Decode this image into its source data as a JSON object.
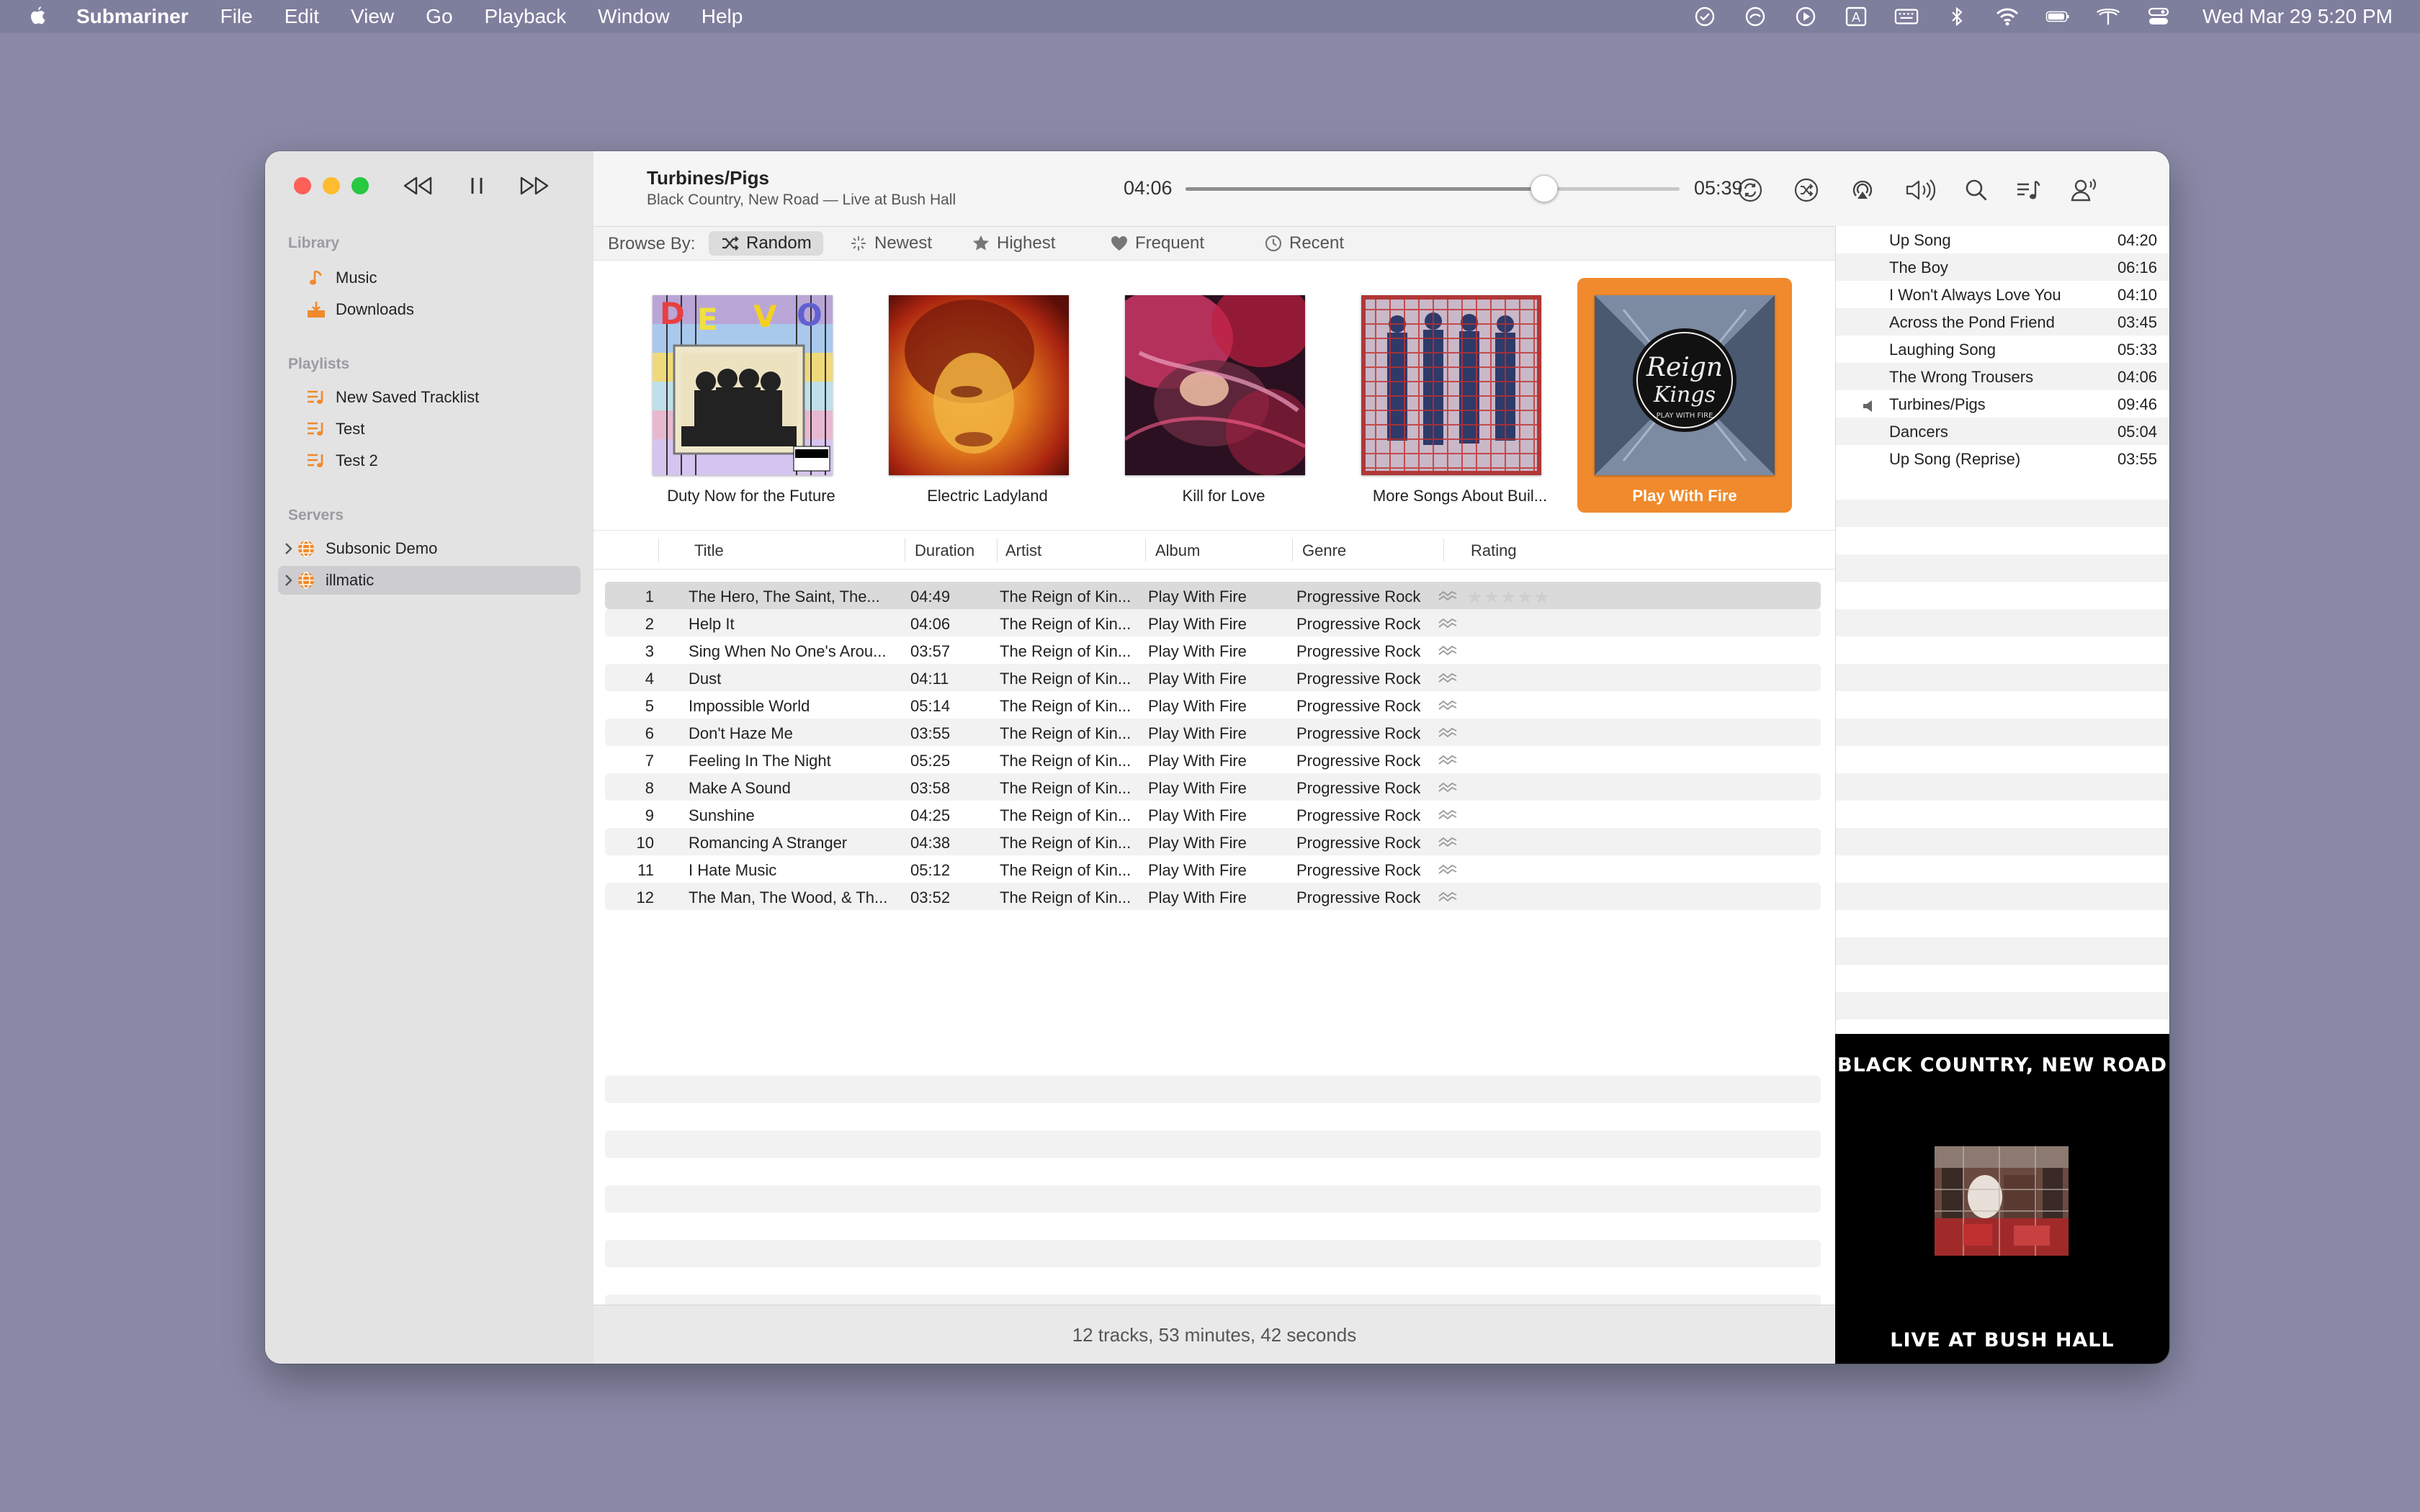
{
  "menubar": {
    "app_name": "Submariner",
    "menus": [
      "File",
      "Edit",
      "View",
      "Go",
      "Playback",
      "Window",
      "Help"
    ],
    "clock": "Wed Mar 29  5:20 PM",
    "status_icons": [
      "checkmark-circle-icon",
      "focus-icon",
      "play-circle-icon",
      "input-source-icon",
      "keyboard-icon",
      "bluetooth-icon",
      "wifi-icon",
      "battery-icon",
      "network-icon",
      "control-center-icon"
    ]
  },
  "sidebar": {
    "library_header": "Library",
    "library": [
      {
        "label": "Music",
        "icon": "music-note-icon"
      },
      {
        "label": "Downloads",
        "icon": "downloads-icon"
      }
    ],
    "playlists_header": "Playlists",
    "playlists": [
      {
        "label": "New Saved Tracklist"
      },
      {
        "label": "Test"
      },
      {
        "label": "Test 2"
      }
    ],
    "servers_header": "Servers",
    "servers": [
      {
        "label": "Subsonic Demo",
        "selected": false
      },
      {
        "label": "illmatic",
        "selected": true
      }
    ]
  },
  "now_playing": {
    "title": "Turbines/Pigs",
    "subtitle": "Black Country, New Road — Live at Bush Hall",
    "elapsed": "04:06",
    "total": "05:39",
    "progress": 0.726
  },
  "browse": {
    "label": "Browse By:",
    "options": [
      {
        "label": "Random",
        "icon": "shuffle-icon",
        "active": true
      },
      {
        "label": "Newest",
        "icon": "sparkle-icon",
        "active": false
      },
      {
        "label": "Highest",
        "icon": "star-icon",
        "active": false
      },
      {
        "label": "Frequent",
        "icon": "heart-icon",
        "active": false
      },
      {
        "label": "Recent",
        "icon": "clock-icon",
        "active": false
      }
    ]
  },
  "albums": [
    {
      "title": "Duty Now for the Future",
      "selected": false
    },
    {
      "title": "Electric Ladyland",
      "selected": false
    },
    {
      "title": "Kill for Love",
      "selected": false
    },
    {
      "title": "More Songs About Buil...",
      "selected": false
    },
    {
      "title": "Play With Fire",
      "selected": true
    }
  ],
  "table": {
    "headers": [
      "Title",
      "Duration",
      "Artist",
      "Album",
      "Genre",
      "Rating"
    ],
    "rows": [
      {
        "num": "1",
        "title": "The Hero, The Saint, The...",
        "duration": "04:49",
        "artist": "The Reign of Kin...",
        "album": "Play With Fire",
        "genre": "Progressive Rock"
      },
      {
        "num": "2",
        "title": "Help It",
        "duration": "04:06",
        "artist": "The Reign of Kin...",
        "album": "Play With Fire",
        "genre": "Progressive Rock"
      },
      {
        "num": "3",
        "title": "Sing When No One's Arou...",
        "duration": "03:57",
        "artist": "The Reign of Kin...",
        "album": "Play With Fire",
        "genre": "Progressive Rock"
      },
      {
        "num": "4",
        "title": "Dust",
        "duration": "04:11",
        "artist": "The Reign of Kin...",
        "album": "Play With Fire",
        "genre": "Progressive Rock"
      },
      {
        "num": "5",
        "title": "Impossible World",
        "duration": "05:14",
        "artist": "The Reign of Kin...",
        "album": "Play With Fire",
        "genre": "Progressive Rock"
      },
      {
        "num": "6",
        "title": "Don't Haze Me",
        "duration": "03:55",
        "artist": "The Reign of Kin...",
        "album": "Play With Fire",
        "genre": "Progressive Rock"
      },
      {
        "num": "7",
        "title": "Feeling In The Night",
        "duration": "05:25",
        "artist": "The Reign of Kin...",
        "album": "Play With Fire",
        "genre": "Progressive Rock"
      },
      {
        "num": "8",
        "title": "Make A Sound",
        "duration": "03:58",
        "artist": "The Reign of Kin...",
        "album": "Play With Fire",
        "genre": "Progressive Rock"
      },
      {
        "num": "9",
        "title": "Sunshine",
        "duration": "04:25",
        "artist": "The Reign of Kin...",
        "album": "Play With Fire",
        "genre": "Progressive Rock"
      },
      {
        "num": "10",
        "title": "Romancing A Stranger",
        "duration": "04:38",
        "artist": "The Reign of Kin...",
        "album": "Play With Fire",
        "genre": "Progressive Rock"
      },
      {
        "num": "11",
        "title": "I Hate Music",
        "duration": "05:12",
        "artist": "The Reign of Kin...",
        "album": "Play With Fire",
        "genre": "Progressive Rock"
      },
      {
        "num": "12",
        "title": "The Man, The Wood, & Th...",
        "duration": "03:52",
        "artist": "The Reign of Kin...",
        "album": "Play With Fire",
        "genre": "Progressive Rock"
      }
    ],
    "rating_stars": "★★★★★",
    "summary": "12 tracks, 53 minutes, 42 seconds"
  },
  "queue": [
    {
      "title": "Up Song",
      "duration": "04:20",
      "playing": false
    },
    {
      "title": "The Boy",
      "duration": "06:16",
      "playing": false
    },
    {
      "title": "I Won't Always Love You",
      "duration": "04:10",
      "playing": false
    },
    {
      "title": "Across the Pond Friend",
      "duration": "03:45",
      "playing": false
    },
    {
      "title": "Laughing Song",
      "duration": "05:33",
      "playing": false
    },
    {
      "title": "The Wrong Trousers",
      "duration": "04:06",
      "playing": false
    },
    {
      "title": "Turbines/Pigs",
      "duration": "09:46",
      "playing": true
    },
    {
      "title": "Dancers",
      "duration": "05:04",
      "playing": false
    },
    {
      "title": "Up Song (Reprise)",
      "duration": "03:55",
      "playing": false
    }
  ],
  "artwork": {
    "top": "BLACK COUNTRY, NEW ROAD",
    "bottom": "LIVE AT BUSH HALL"
  },
  "colors": {
    "accent": "#f08a2c",
    "desktop": "#8a8aa8",
    "sidebar": "#e3e3e4"
  }
}
